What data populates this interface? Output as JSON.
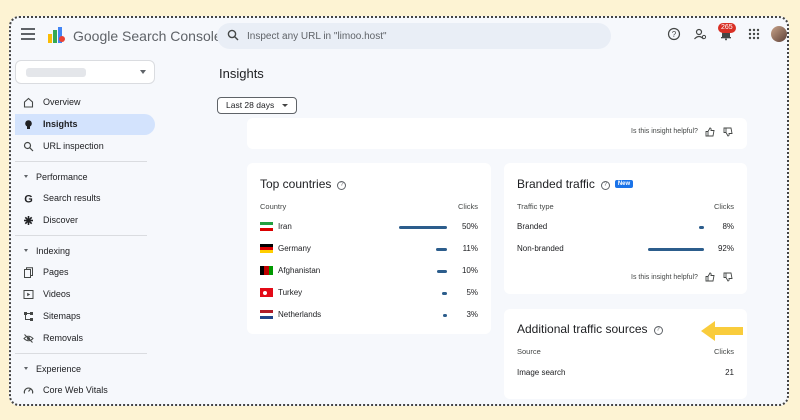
{
  "header": {
    "app_title": "Google Search Console",
    "search_placeholder": "Inspect any URL in \"limoo.host\"",
    "notification_count": "265"
  },
  "sidebar": {
    "overview": "Overview",
    "insights": "Insights",
    "url_inspection": "URL inspection",
    "performance_section": "Performance",
    "search_results": "Search results",
    "discover": "Discover",
    "indexing_section": "Indexing",
    "pages": "Pages",
    "videos": "Videos",
    "sitemaps": "Sitemaps",
    "removals": "Removals",
    "experience_section": "Experience",
    "core_web_vitals": "Core Web Vitals"
  },
  "main": {
    "page_title": "Insights",
    "date_range": "Last 28 days",
    "helpful_prompt": "Is this insight helpful?",
    "top_countries": {
      "title": "Top countries",
      "col_country": "Country",
      "col_clicks": "Clicks",
      "rows": [
        {
          "name": "Iran",
          "value": "50%",
          "share": 0.5
        },
        {
          "name": "Germany",
          "value": "11%",
          "share": 0.11
        },
        {
          "name": "Afghanistan",
          "value": "10%",
          "share": 0.1
        },
        {
          "name": "Turkey",
          "value": "5%",
          "share": 0.05
        },
        {
          "name": "Netherlands",
          "value": "3%",
          "share": 0.03
        }
      ]
    },
    "branded_traffic": {
      "title": "Branded traffic",
      "badge": "New",
      "col_type": "Traffic type",
      "col_clicks": "Clicks",
      "rows": [
        {
          "name": "Branded",
          "value": "8%",
          "share": 0.08
        },
        {
          "name": "Non-branded",
          "value": "92%",
          "share": 0.92
        }
      ]
    },
    "additional_sources": {
      "title": "Additional traffic sources",
      "col_source": "Source",
      "col_clicks": "Clicks",
      "rows": [
        {
          "name": "Image search",
          "value": "21"
        }
      ]
    }
  },
  "colors": {
    "page_bg": "#fdf3d3",
    "app_bg": "#f6f8fc",
    "active_nav": "#d3e3fd",
    "bar": "#2c5d8c",
    "arrow": "#f9cc3c",
    "badge_new": "#1a73e8",
    "notification": "#d93025"
  }
}
